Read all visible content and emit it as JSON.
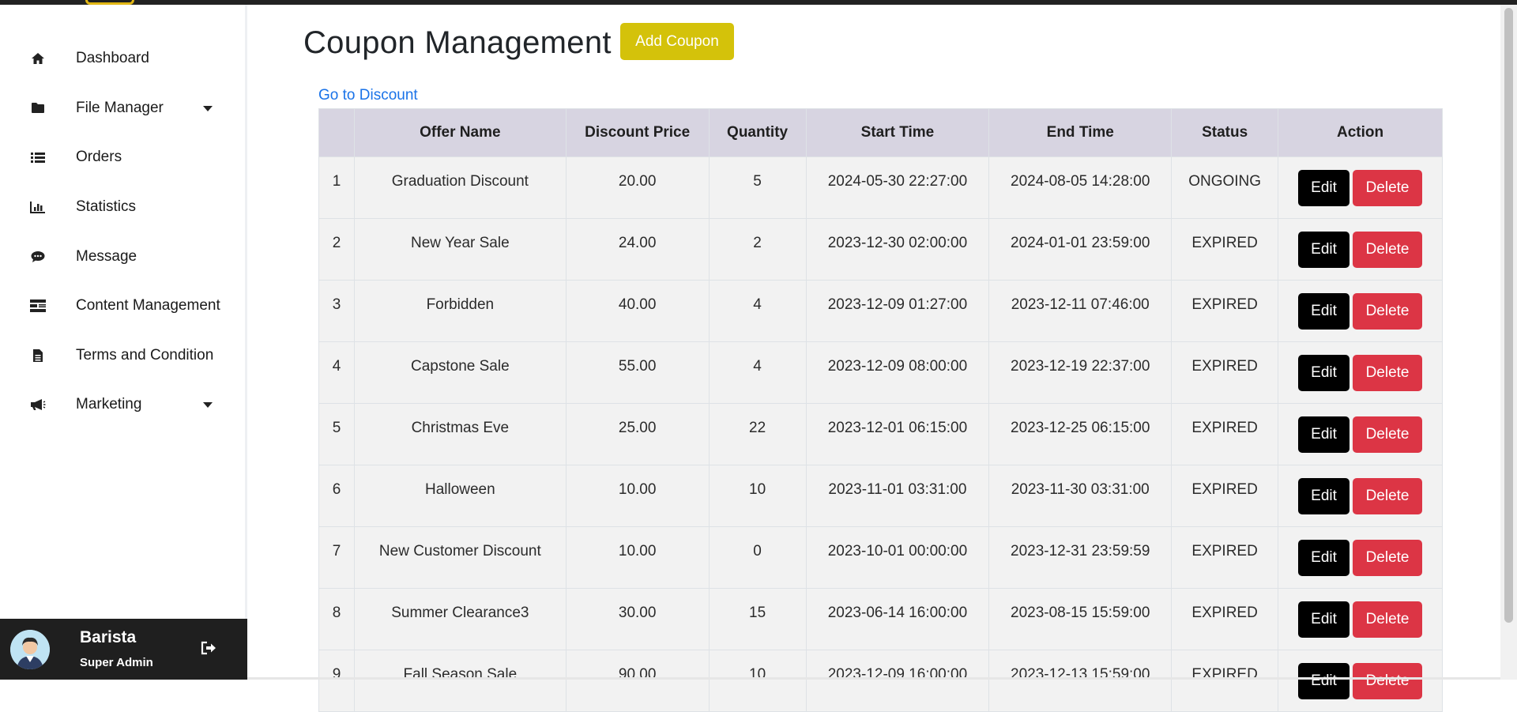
{
  "sidebar": {
    "items": [
      {
        "label": "Dashboard",
        "icon": "home-icon"
      },
      {
        "label": "File Manager",
        "icon": "folder-icon",
        "has_dropdown": true
      },
      {
        "label": "Orders",
        "icon": "list-icon"
      },
      {
        "label": "Statistics",
        "icon": "bar-chart-icon"
      },
      {
        "label": "Message",
        "icon": "chat-icon"
      },
      {
        "label": "Content Management",
        "icon": "content-icon"
      },
      {
        "label": "Terms and Condition",
        "icon": "document-icon"
      },
      {
        "label": "Marketing",
        "icon": "megaphone-icon",
        "has_dropdown": true
      }
    ],
    "profile": {
      "name": "Barista",
      "role": "Super Admin"
    }
  },
  "main": {
    "title": "Coupon Management",
    "add_button": "Add Coupon",
    "link": "Go to Discount",
    "table": {
      "headers": [
        "",
        "Offer Name",
        "Discount Price",
        "Quantity",
        "Start Time",
        "End Time",
        "Status",
        "Action"
      ],
      "rows": [
        {
          "no": "1",
          "name": "Graduation Discount",
          "price": "20.00",
          "qty": "5",
          "start": "2024-05-30 22:27:00",
          "end": "2024-08-05 14:28:00",
          "status": "ONGOING"
        },
        {
          "no": "2",
          "name": "New Year Sale",
          "price": "24.00",
          "qty": "2",
          "start": "2023-12-30 02:00:00",
          "end": "2024-01-01 23:59:00",
          "status": "EXPIRED"
        },
        {
          "no": "3",
          "name": "Forbidden",
          "price": "40.00",
          "qty": "4",
          "start": "2023-12-09 01:27:00",
          "end": "2023-12-11 07:46:00",
          "status": "EXPIRED"
        },
        {
          "no": "4",
          "name": "Capstone Sale",
          "price": "55.00",
          "qty": "4",
          "start": "2023-12-09 08:00:00",
          "end": "2023-12-19 22:37:00",
          "status": "EXPIRED"
        },
        {
          "no": "5",
          "name": "Christmas Eve",
          "price": "25.00",
          "qty": "22",
          "start": "2023-12-01 06:15:00",
          "end": "2023-12-25 06:15:00",
          "status": "EXPIRED"
        },
        {
          "no": "6",
          "name": "Halloween",
          "price": "10.00",
          "qty": "10",
          "start": "2023-11-01 03:31:00",
          "end": "2023-11-30 03:31:00",
          "status": "EXPIRED"
        },
        {
          "no": "7",
          "name": "New Customer Discount",
          "price": "10.00",
          "qty": "0",
          "start": "2023-10-01 00:00:00",
          "end": "2023-12-31 23:59:59",
          "status": "EXPIRED"
        },
        {
          "no": "8",
          "name": "Summer Clearance3",
          "price": "30.00",
          "qty": "15",
          "start": "2023-06-14 16:00:00",
          "end": "2023-08-15 15:59:00",
          "status": "EXPIRED"
        },
        {
          "no": "9",
          "name": "Fall Season Sale",
          "price": "90.00",
          "qty": "10",
          "start": "2023-12-09 16:00:00",
          "end": "2023-12-13 15:59:00",
          "status": "EXPIRED"
        }
      ],
      "edit_label": "Edit",
      "delete_label": "Delete"
    }
  },
  "colors": {
    "accent": "#d4c20a",
    "danger": "#dc3545",
    "link": "#1a73e8",
    "header_bg": "#d7d4e1",
    "profile_bg": "#1f1f1f"
  }
}
